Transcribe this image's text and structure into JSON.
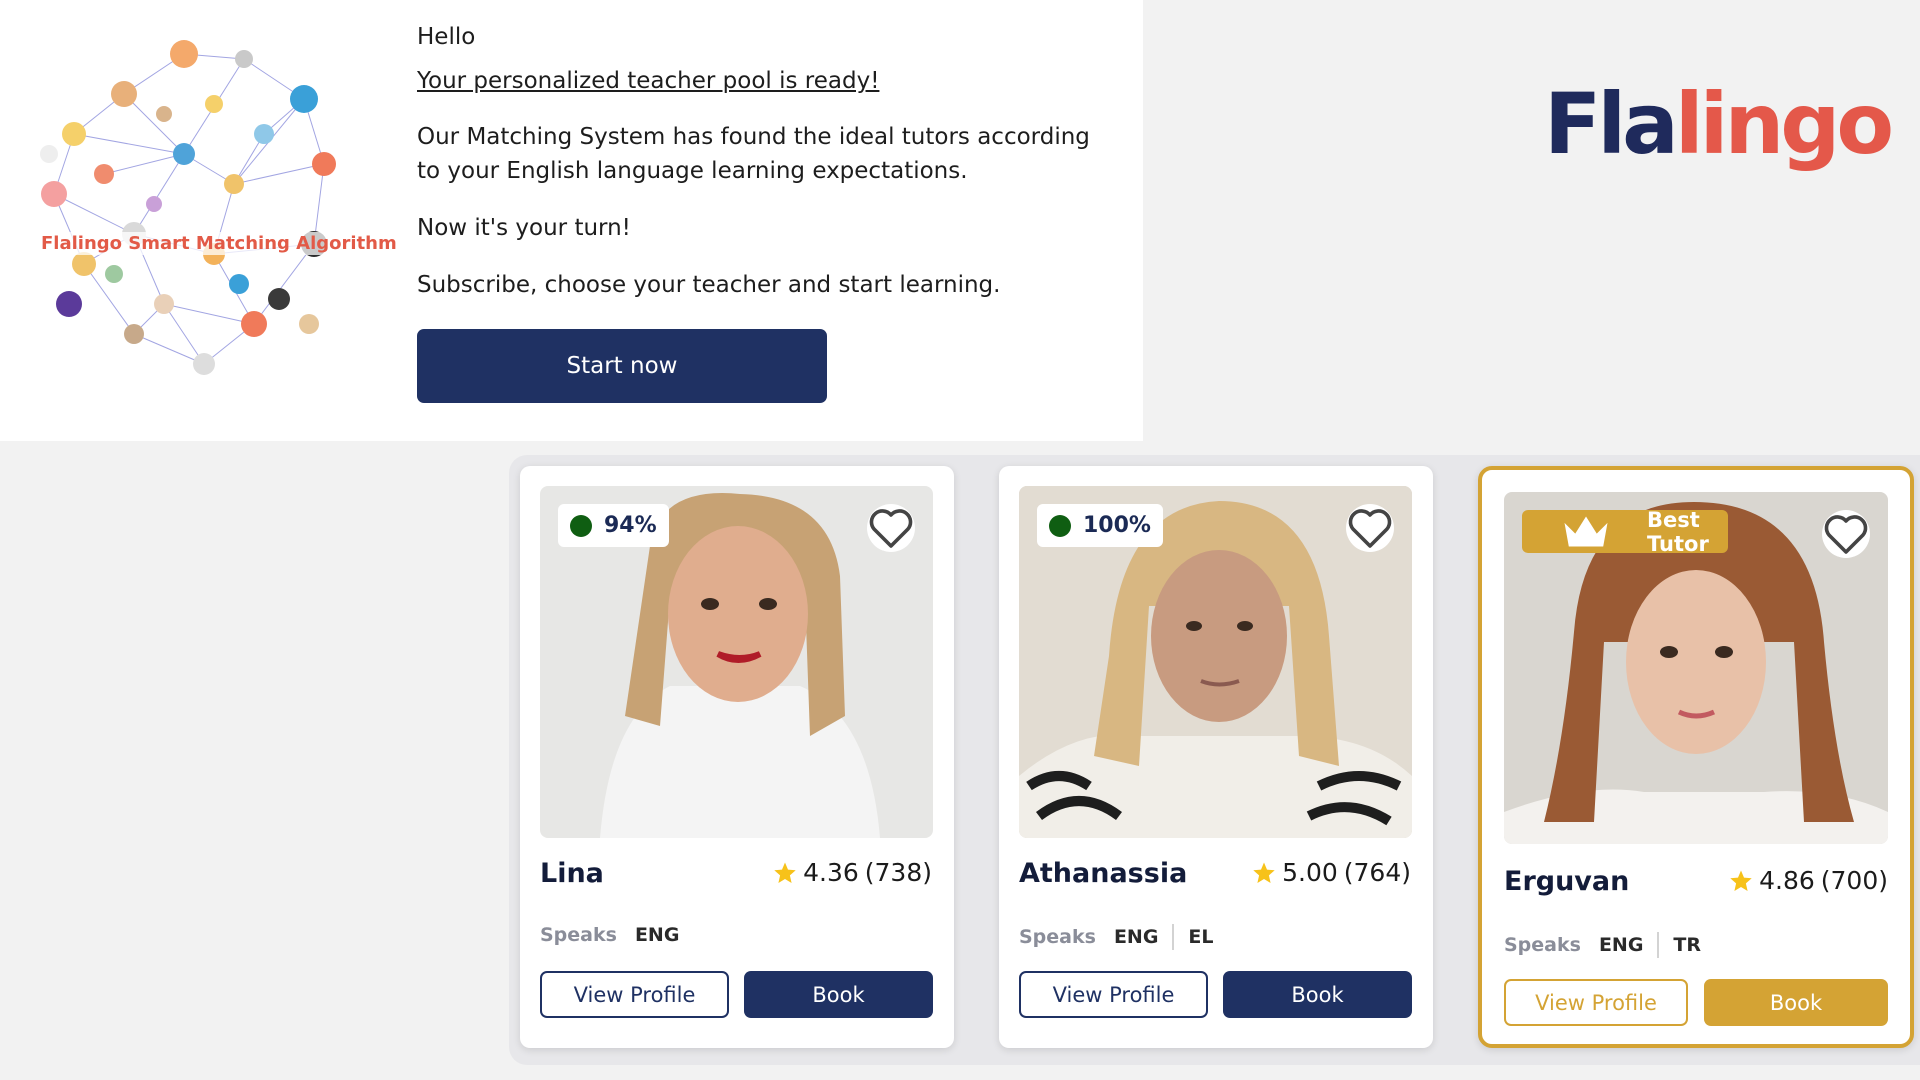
{
  "email": {
    "greeting": "Hello",
    "headline": "Your personalized teacher pool is ready!",
    "body": "Our Matching System has found the ideal tutors according to your English language learning expectations.",
    "turn": "Now it's your turn!",
    "cta_text": "Subscribe, choose your teacher and start learning.",
    "start_button": "Start now",
    "algorithm_label": "Flalingo Smart Matching Algorithm"
  },
  "logo": {
    "part1": "Fla",
    "part2": "lingo"
  },
  "colors": {
    "navy": "#1f3163",
    "coral": "#e4584a",
    "gold": "#d4a334",
    "online_green": "#0f5e12"
  },
  "tutors": [
    {
      "name": "Lina",
      "badge_type": "match",
      "match": "94%",
      "rating": "4.36",
      "reviews": "(738)",
      "speaks_label": "Speaks",
      "languages": [
        "ENG"
      ],
      "view_label": "View Profile",
      "book_label": "Book"
    },
    {
      "name": "Athanassia",
      "badge_type": "match",
      "match": "100%",
      "rating": "5.00",
      "reviews": "(764)",
      "speaks_label": "Speaks",
      "languages": [
        "ENG",
        "EL"
      ],
      "view_label": "View Profile",
      "book_label": "Book"
    },
    {
      "name": "Erguvan",
      "badge_type": "best",
      "badge": "Best Tutor",
      "rating": "4.86",
      "reviews": "(700)",
      "speaks_label": "Speaks",
      "languages": [
        "ENG",
        "TR"
      ],
      "view_label": "View Profile",
      "book_label": "Book"
    }
  ]
}
